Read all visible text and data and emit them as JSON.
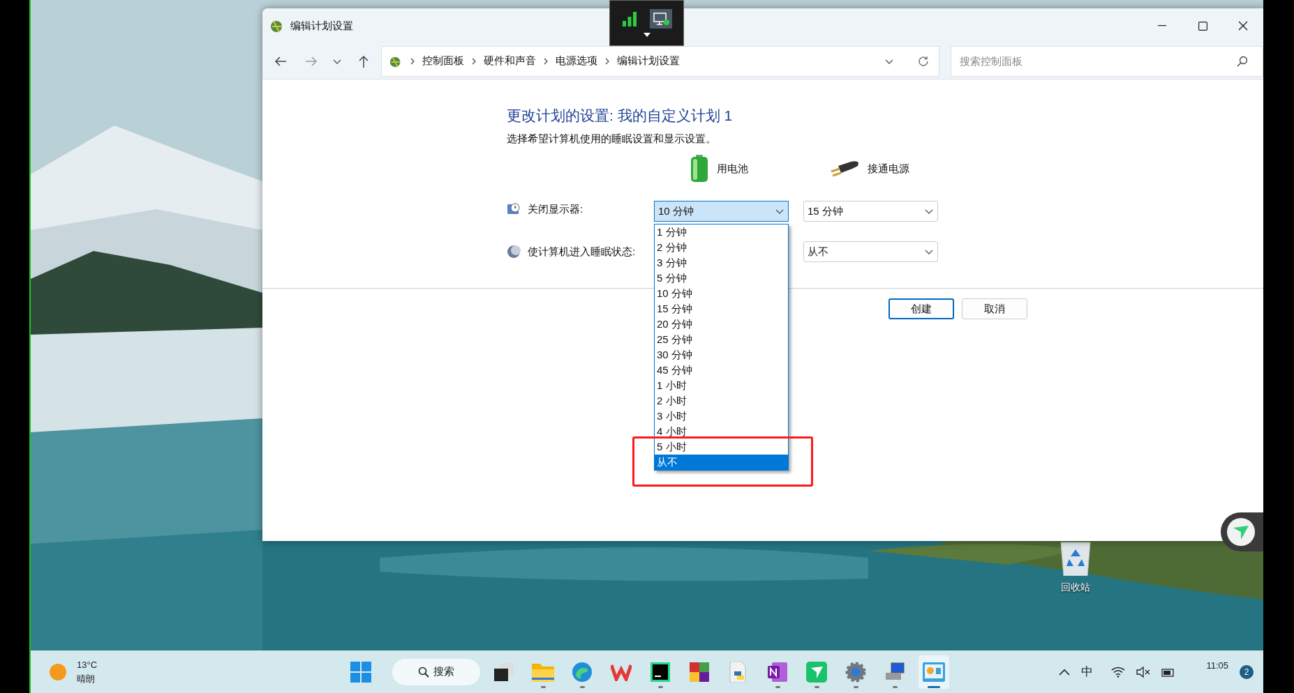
{
  "window": {
    "title": "编辑计划设置"
  },
  "nav": {
    "breadcrumb": [
      "控制面板",
      "硬件和声音",
      "电源选项",
      "编辑计划设置"
    ],
    "search_placeholder": "搜索控制面板"
  },
  "heading": "更改计划的设置: 我的自定义计划 1",
  "subtitle": "选择希望计算机使用的睡眠设置和显示设置。",
  "columns": [
    {
      "kind": "battery",
      "label": "用电池"
    },
    {
      "kind": "plugged",
      "label": "接通电源"
    }
  ],
  "settings": [
    {
      "kind": "display",
      "label": "关闭显示器:",
      "on_battery": "10 分钟",
      "plugged_in": "15 分钟",
      "expanded": true
    },
    {
      "kind": "sleep",
      "label": "使计算机进入睡眠状态:",
      "plugged_in": "从不"
    }
  ],
  "dropdown_options": [
    {
      "label": "1 分钟",
      "selected": false
    },
    {
      "label": "2 分钟",
      "selected": false
    },
    {
      "label": "3 分钟",
      "selected": false
    },
    {
      "label": "5 分钟",
      "selected": false
    },
    {
      "label": "10 分钟",
      "selected": false
    },
    {
      "label": "15 分钟",
      "selected": false
    },
    {
      "label": "20 分钟",
      "selected": false
    },
    {
      "label": "25 分钟",
      "selected": false
    },
    {
      "label": "30 分钟",
      "selected": false
    },
    {
      "label": "45 分钟",
      "selected": false
    },
    {
      "label": "1 小时",
      "selected": false
    },
    {
      "label": "2 小时",
      "selected": false
    },
    {
      "label": "3 小时",
      "selected": false
    },
    {
      "label": "4 小时",
      "selected": false
    },
    {
      "label": "5 小时",
      "selected": false
    },
    {
      "label": "从不",
      "selected": true
    }
  ],
  "buttons": [
    {
      "label": "创建",
      "kind": "primary"
    },
    {
      "label": "取消",
      "kind": "secondary"
    }
  ],
  "desktop_icons": [
    {
      "label": "回收站"
    }
  ],
  "taskbar": {
    "weather": {
      "temperature": "13°C",
      "condition": "晴朗"
    },
    "search": "搜索",
    "ime": "中",
    "time": "11:05",
    "notification_count": "2",
    "apps": [
      {
        "kind": "task-view",
        "running": false,
        "active": false
      },
      {
        "kind": "folder",
        "running": true,
        "active": false
      },
      {
        "kind": "browser",
        "running": true,
        "active": false
      },
      {
        "kind": "w-logo",
        "running": false,
        "active": false
      },
      {
        "kind": "ide",
        "running": true,
        "active": false
      },
      {
        "kind": "blocks",
        "running": false,
        "active": false
      },
      {
        "kind": "python",
        "running": false,
        "active": false
      },
      {
        "kind": "notes",
        "running": true,
        "active": false
      },
      {
        "kind": "send",
        "running": true,
        "active": false
      },
      {
        "kind": "gear",
        "running": true,
        "active": false
      },
      {
        "kind": "computer",
        "running": true,
        "active": false
      },
      {
        "kind": "control-panel",
        "running": true,
        "active": true
      }
    ]
  }
}
